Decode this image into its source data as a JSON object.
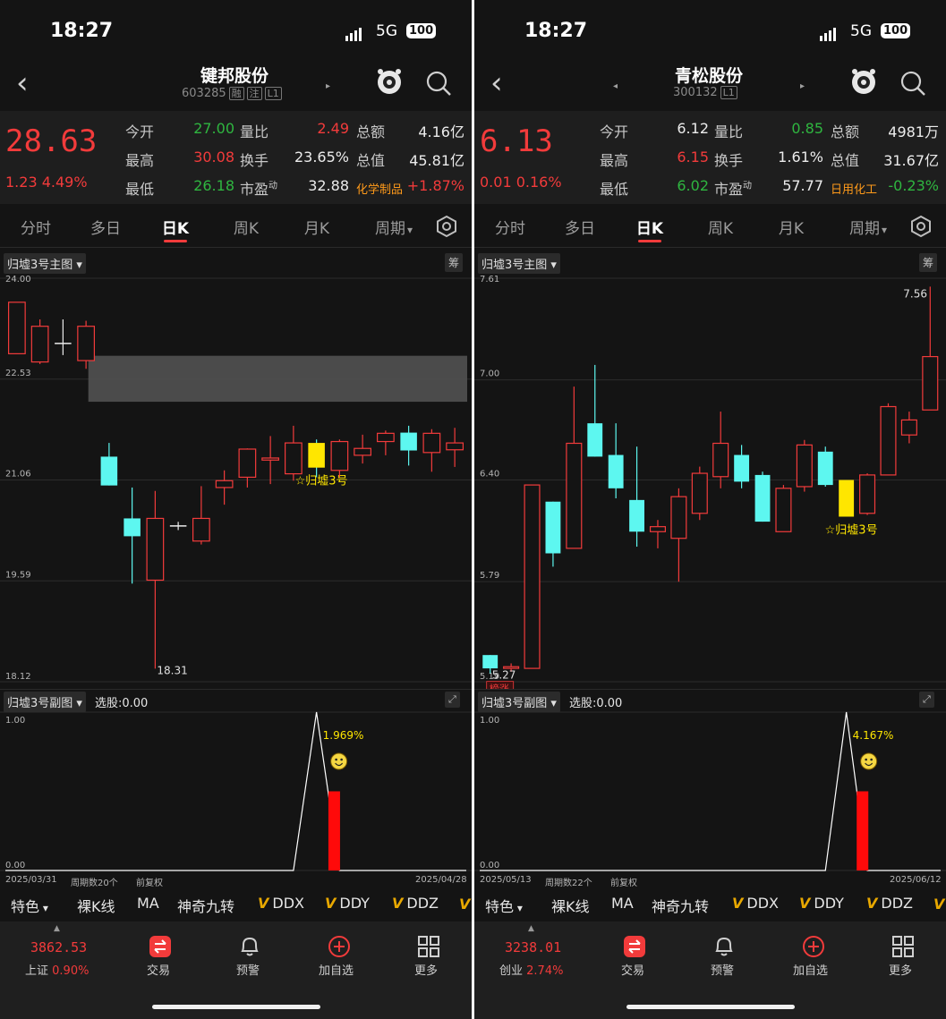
{
  "theme": {
    "up": "#f23b3b",
    "down": "#5df7f0",
    "neutral": "#ececec",
    "signal": "#ffe600",
    "bg": "#141414"
  },
  "panels": [
    {
      "status": {
        "time": "18:27",
        "network": "5G",
        "battery": "100"
      },
      "header": {
        "name": "键邦股份",
        "code": "603285",
        "tags": [
          "融",
          "注",
          "L1"
        ]
      },
      "quote": {
        "price": "28.63",
        "change": "1.23",
        "change_pct": "4.49%",
        "rows": [
          [
            {
              "label": "今开",
              "value": "27.00",
              "color": "green"
            },
            {
              "label": "量比",
              "value": "2.49",
              "color": "red"
            },
            {
              "label": "总额",
              "value": "4.16亿",
              "color": "white"
            }
          ],
          [
            {
              "label": "最高",
              "value": "30.08",
              "color": "red"
            },
            {
              "label": "换手",
              "value": "23.65%",
              "color": "white"
            },
            {
              "label": "总值",
              "value": "45.81亿",
              "color": "white"
            }
          ],
          [
            {
              "label": "最低",
              "value": "26.18",
              "color": "green"
            },
            {
              "label": "市盈",
              "sup": "动",
              "value": "32.88",
              "color": "white"
            },
            {
              "label": "化学制品",
              "value": "+1.87%",
              "color": "red"
            }
          ]
        ]
      },
      "tabs": [
        "分时",
        "多日",
        "日K",
        "周K",
        "月K",
        "周期"
      ],
      "active_tab": "日K",
      "main_chart_title": "归墟3号主图",
      "chip_label": "筹",
      "signal_label": "☆归墟3号",
      "sub_title": "归墟3号副图",
      "pick_label": "选股:0.00",
      "pct_label": "1.969%",
      "date_start": "2025/03/31",
      "period_label": "周期数20个",
      "adj_label": "前复权",
      "date_end": "2025/04/28",
      "indicators": [
        "特色",
        "裸K线",
        "MA",
        "神奇九转",
        "DDX",
        "DDY",
        "DDZ"
      ],
      "bottom": {
        "index_value": "3862.53",
        "index_name": "上证",
        "index_pct": "0.90%",
        "items": [
          "交易",
          "预警",
          "加自选",
          "更多"
        ]
      },
      "chart_data": {
        "type": "candlestick",
        "y_ticks": [
          "24.00",
          "22.53",
          "21.06",
          "19.59",
          "18.12"
        ],
        "ylim": [
          18.12,
          24.0
        ],
        "sub_ticks": [
          "1.00",
          "0.00"
        ],
        "min_annotation": "18.31",
        "zone": [
          22.2,
          22.87
        ],
        "signal_index": 13,
        "sub_peak_index": 13,
        "sub_bar_value": 0.5,
        "candles": [
          {
            "o": 22.9,
            "c": 23.65,
            "h": 23.65,
            "l": 22.9
          },
          {
            "o": 22.78,
            "c": 23.3,
            "h": 23.4,
            "l": 22.75
          },
          {
            "o": 23.05,
            "c": 23.05,
            "h": 23.4,
            "l": 22.88
          },
          {
            "o": 22.8,
            "c": 23.3,
            "h": 23.38,
            "l": 22.68
          },
          {
            "o": 21.4,
            "c": 20.98,
            "h": 21.6,
            "l": 20.98
          },
          {
            "o": 20.5,
            "c": 20.24,
            "h": 20.95,
            "l": 19.55
          },
          {
            "o": 19.6,
            "c": 20.5,
            "h": 20.9,
            "l": 18.31
          },
          {
            "o": 20.39,
            "c": 20.39,
            "h": 20.45,
            "l": 20.33
          },
          {
            "o": 20.17,
            "c": 20.5,
            "h": 20.97,
            "l": 20.12
          },
          {
            "o": 20.95,
            "c": 21.05,
            "h": 21.2,
            "l": 20.7
          },
          {
            "o": 21.1,
            "c": 21.51,
            "h": 21.52,
            "l": 20.95
          },
          {
            "o": 21.35,
            "c": 21.38,
            "h": 21.7,
            "l": 21.0
          },
          {
            "o": 21.15,
            "c": 21.6,
            "h": 21.85,
            "l": 21.05
          },
          {
            "o": 21.6,
            "c": 21.24,
            "h": 21.65,
            "l": 21.1
          },
          {
            "o": 21.2,
            "c": 21.62,
            "h": 21.65,
            "l": 21.1
          },
          {
            "o": 21.42,
            "c": 21.52,
            "h": 21.72,
            "l": 21.3
          },
          {
            "o": 21.62,
            "c": 21.74,
            "h": 21.78,
            "l": 21.42
          },
          {
            "o": 21.75,
            "c": 21.49,
            "h": 21.85,
            "l": 21.27
          },
          {
            "o": 21.46,
            "c": 21.74,
            "h": 21.8,
            "l": 21.18
          },
          {
            "o": 21.5,
            "c": 21.6,
            "h": 21.82,
            "l": 21.25
          }
        ]
      }
    },
    {
      "status": {
        "time": "18:27",
        "network": "5G",
        "battery": "100"
      },
      "header": {
        "name": "青松股份",
        "code": "300132",
        "tags": [
          "L1"
        ]
      },
      "quote": {
        "price": "6.13",
        "change": "0.01",
        "change_pct": "0.16%",
        "rows": [
          [
            {
              "label": "今开",
              "value": "6.12",
              "color": "white"
            },
            {
              "label": "量比",
              "value": "0.85",
              "color": "green"
            },
            {
              "label": "总额",
              "value": "4981万",
              "color": "white"
            }
          ],
          [
            {
              "label": "最高",
              "value": "6.15",
              "color": "red"
            },
            {
              "label": "换手",
              "value": "1.61%",
              "color": "white"
            },
            {
              "label": "总值",
              "value": "31.67亿",
              "color": "white"
            }
          ],
          [
            {
              "label": "最低",
              "value": "6.02",
              "color": "green"
            },
            {
              "label": "市盈",
              "sup": "动",
              "value": "57.77",
              "color": "white"
            },
            {
              "label": "日用化工",
              "value": "-0.23%",
              "color": "green"
            }
          ]
        ]
      },
      "tabs": [
        "分时",
        "多日",
        "日K",
        "周K",
        "月K",
        "周期"
      ],
      "active_tab": "日K",
      "main_chart_title": "归墟3号主图",
      "chip_label": "筹",
      "signal_label": "☆归墟3号",
      "sub_title": "归墟3号副图",
      "pick_label": "选股:0.00",
      "pct_label": "4.167%",
      "date_start": "2025/05/13",
      "period_label": "周期数22个",
      "adj_label": "前复权",
      "date_end": "2025/06/12",
      "indicators": [
        "特色",
        "裸K线",
        "MA",
        "神奇九转",
        "DDX",
        "DDY",
        "DDZ"
      ],
      "bottom": {
        "index_value": "3238.01",
        "index_name": "创业",
        "index_pct": "2.74%",
        "items": [
          "交易",
          "预警",
          "加自选",
          "更多"
        ]
      },
      "chart_data": {
        "type": "candlestick",
        "y_ticks": [
          "7.61",
          "7.00",
          "6.40",
          "5.79",
          "5.19"
        ],
        "ylim": [
          5.19,
          7.61
        ],
        "sub_ticks": [
          "1.00",
          "0.00"
        ],
        "max_annotation": "7.56",
        "min_annotation": "5.27",
        "tag": "榜涨",
        "signal_index": 17,
        "sub_peak_index": 17,
        "sub_bar_value": 0.5,
        "candles": [
          {
            "o": 5.35,
            "c": 5.27,
            "h": 5.35,
            "l": 5.24
          },
          {
            "o": 5.27,
            "c": 5.28,
            "h": 5.3,
            "l": 5.25
          },
          {
            "o": 5.27,
            "c": 6.37,
            "h": 6.37,
            "l": 5.27
          },
          {
            "o": 6.27,
            "c": 5.96,
            "h": 6.27,
            "l": 5.88
          },
          {
            "o": 5.99,
            "c": 6.62,
            "h": 6.96,
            "l": 5.99
          },
          {
            "o": 6.74,
            "c": 6.54,
            "h": 7.09,
            "l": 6.54
          },
          {
            "o": 6.55,
            "c": 6.35,
            "h": 6.74,
            "l": 6.29
          },
          {
            "o": 6.28,
            "c": 6.09,
            "h": 6.6,
            "l": 6.0
          },
          {
            "o": 6.09,
            "c": 6.12,
            "h": 6.16,
            "l": 5.99
          },
          {
            "o": 6.05,
            "c": 6.3,
            "h": 6.35,
            "l": 5.79
          },
          {
            "o": 6.2,
            "c": 6.44,
            "h": 6.48,
            "l": 6.16
          },
          {
            "o": 6.42,
            "c": 6.62,
            "h": 6.81,
            "l": 6.35
          },
          {
            "o": 6.55,
            "c": 6.39,
            "h": 6.61,
            "l": 6.35
          },
          {
            "o": 6.43,
            "c": 6.15,
            "h": 6.45,
            "l": 6.15
          },
          {
            "o": 6.09,
            "c": 6.35,
            "h": 6.37,
            "l": 6.09
          },
          {
            "o": 6.36,
            "c": 6.61,
            "h": 6.64,
            "l": 6.33
          },
          {
            "o": 6.57,
            "c": 6.37,
            "h": 6.6,
            "l": 6.36
          },
          {
            "o": 6.4,
            "c": 6.18,
            "h": 6.4,
            "l": 6.18
          },
          {
            "o": 6.2,
            "c": 6.43,
            "h": 6.44,
            "l": 6.19
          },
          {
            "o": 6.43,
            "c": 6.84,
            "h": 6.86,
            "l": 6.43
          },
          {
            "o": 6.67,
            "c": 6.76,
            "h": 6.81,
            "l": 6.62
          },
          {
            "o": 6.82,
            "c": 7.14,
            "h": 7.56,
            "l": 6.82
          }
        ]
      }
    }
  ]
}
